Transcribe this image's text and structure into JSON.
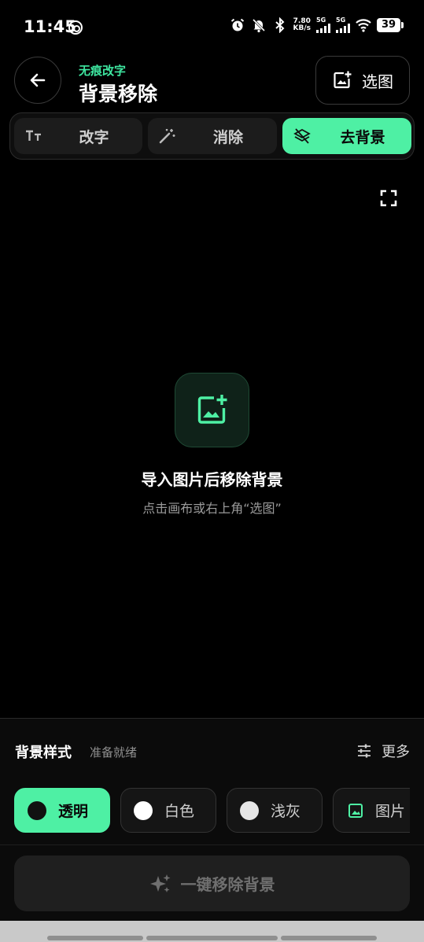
{
  "status_bar": {
    "time": "11:45",
    "speed_value": "7.80",
    "speed_unit": "KB/s",
    "sim1": "5G",
    "sim2": "5G",
    "battery": "39",
    "icons": [
      "netease-music-icon",
      "alarm-icon",
      "mute-icon",
      "bluetooth-icon",
      "wifi-icon"
    ]
  },
  "header": {
    "subtitle": "无痕改字",
    "title": "背景移除",
    "pick_label": "选图"
  },
  "tabs": [
    {
      "label": "改字",
      "icon": "text-size-icon",
      "active": false
    },
    {
      "label": "消除",
      "icon": "magic-wand-icon",
      "active": false
    },
    {
      "label": "去背景",
      "icon": "layers-off-icon",
      "active": true
    }
  ],
  "canvas": {
    "empty_title": "导入图片后移除背景",
    "empty_hint": "点击画布或右上角“选图”"
  },
  "panel": {
    "title": "背景样式",
    "status": "准备就绪",
    "more_label": "更多",
    "styles": [
      {
        "label": "透明",
        "dot_color": "#111111",
        "selected": true
      },
      {
        "label": "白色",
        "dot_color": "#ffffff",
        "selected": false
      },
      {
        "label": "浅灰",
        "dot_color": "#e6e6e6",
        "selected": false
      },
      {
        "label": "图片",
        "icon": "image-icon",
        "selected": false
      }
    ],
    "main_action": "一键移除背景"
  },
  "colors": {
    "accent": "#4ef0a4",
    "accent_text": "#3ee6a0",
    "background": "#000000"
  }
}
